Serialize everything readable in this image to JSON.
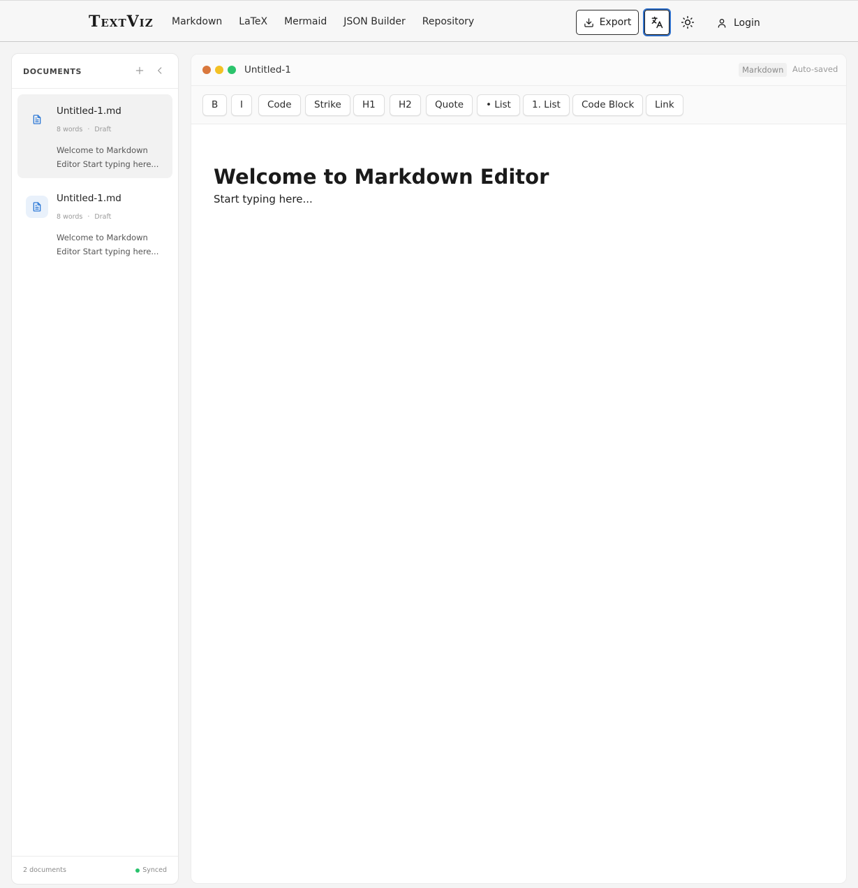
{
  "app": {
    "logo": "TextViz",
    "nav": [
      "Markdown",
      "LaTeX",
      "Mermaid",
      "JSON Builder",
      "Repository"
    ],
    "export_label": "Export",
    "login_label": "Login",
    "icons": {
      "export": "download-icon",
      "translate": "translate-icon",
      "theme": "sun-icon",
      "login": "user-icon"
    }
  },
  "sidebar": {
    "title": "DOCUMENTS",
    "documents": [
      {
        "name": "Untitled-1.md",
        "words": "8 words",
        "status": "Draft",
        "preview": "Welcome to Markdown Editor Start typing here...",
        "active": true
      },
      {
        "name": "Untitled-1.md",
        "words": "8 words",
        "status": "Draft",
        "preview": "Welcome to Markdown Editor Start typing here...",
        "active": false
      }
    ],
    "footer": {
      "count": "2 documents",
      "sync": "Synced",
      "sync_color": "#28c26c"
    }
  },
  "editor": {
    "window_dots": [
      "#d9783d",
      "#f3c125",
      "#2cc46c"
    ],
    "title": "Untitled-1",
    "mode": "Markdown",
    "save_status": "Auto-saved",
    "toolbar": [
      "B",
      "I",
      "Code",
      "Strike",
      "H1",
      "H2",
      "Quote",
      "• List",
      "1. List",
      "Code Block",
      "Link"
    ],
    "content": {
      "heading": "Welcome to Markdown Editor",
      "body": "Start typing here..."
    }
  },
  "colors": {
    "accent": "#2f6fc9",
    "doc_icon": "#2f7ad6"
  }
}
